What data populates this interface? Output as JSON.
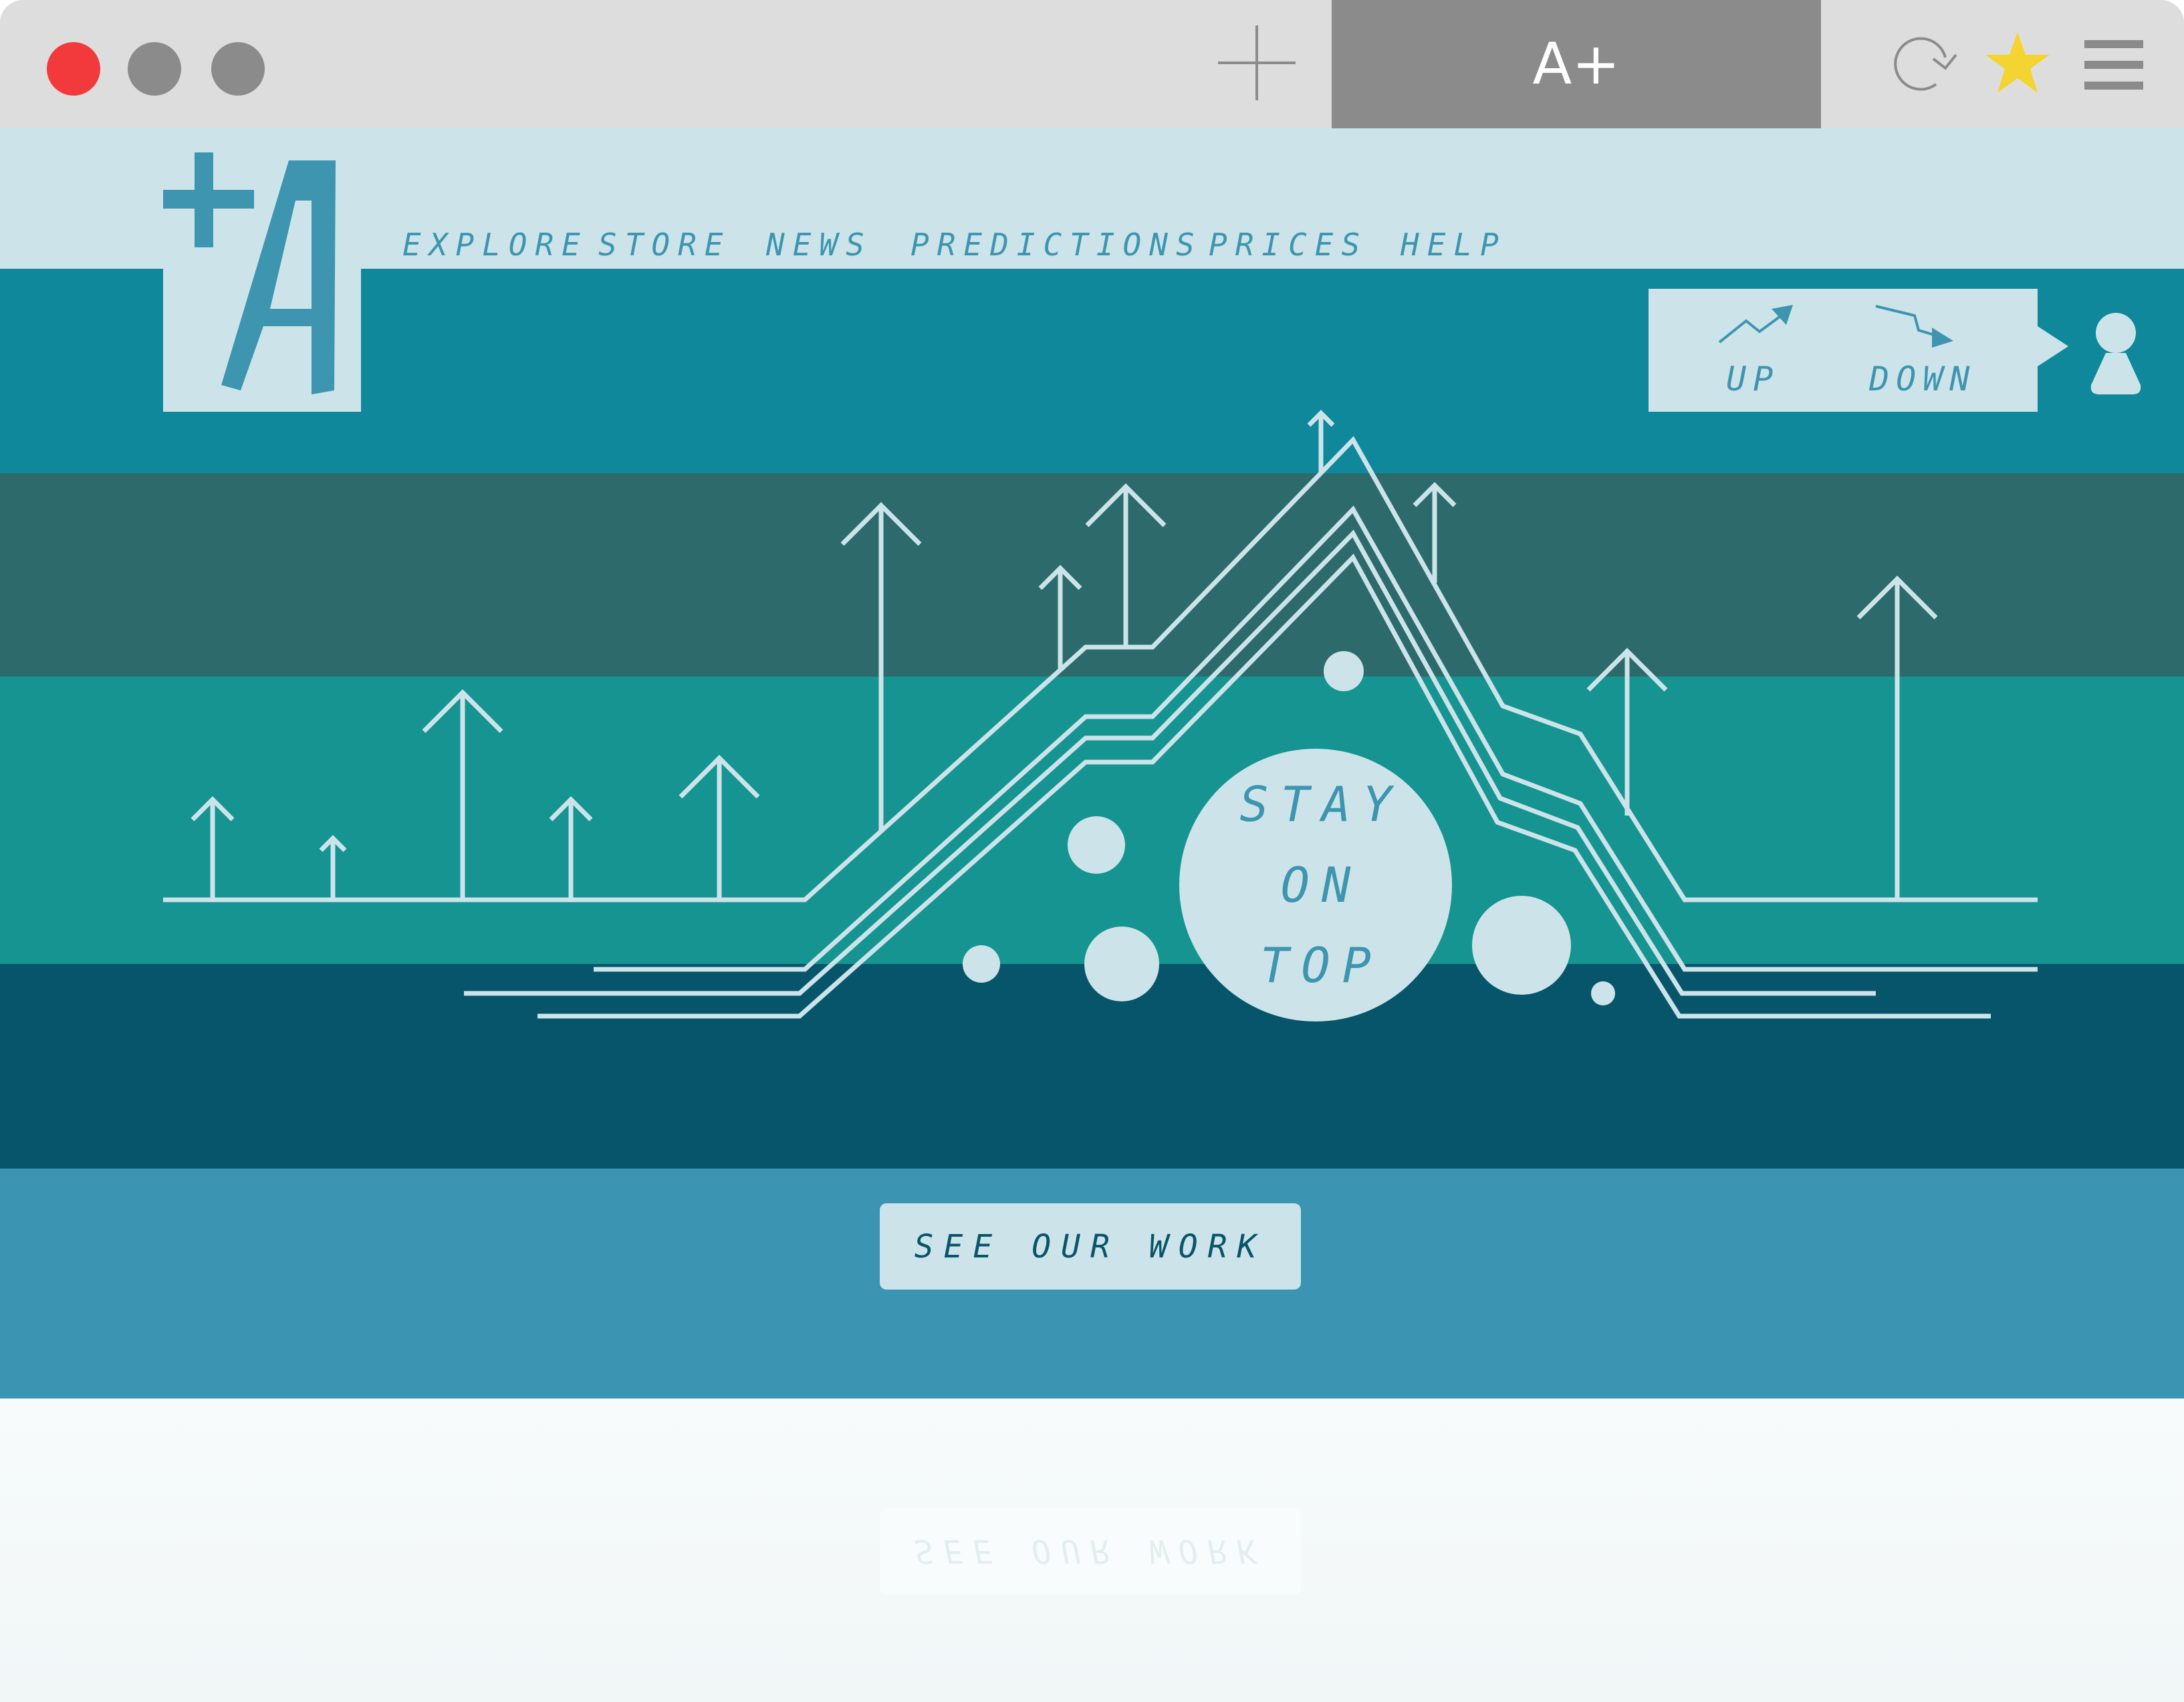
{
  "browser": {
    "tab_title": "A+",
    "window_buttons": [
      "close",
      "minimize",
      "maximize"
    ],
    "toolbar_icons": [
      "new-tab-plus-icon",
      "reload-icon",
      "bookmark-star-icon",
      "menu-icon"
    ],
    "colors": {
      "close": "#f23a3c",
      "inactive_dot": "#8b8b8b",
      "star": "#f4d430",
      "chrome": "#dddddd",
      "active_tab": "#8b8b8b"
    }
  },
  "site": {
    "logo_text": "+A",
    "nav": [
      "EXPLORE",
      "STORE",
      "NEWS",
      "PREDICTIONS",
      "PRICES",
      "HELP"
    ],
    "trend": {
      "up_label": "UP",
      "down_label": "DOWN"
    },
    "hero": {
      "line1": "STAY",
      "line2": "ON",
      "line3": "TOP"
    },
    "cta_label": "SEE OUR WORK",
    "colors": {
      "header": "#cce4e9",
      "band1": "#0e889a",
      "band2": "#2d6a6c",
      "band3": "#159491",
      "band4": "#07556a",
      "cta_band": "#3a94b2",
      "accent": "#3d95b0",
      "line": "#cce4e9"
    }
  }
}
